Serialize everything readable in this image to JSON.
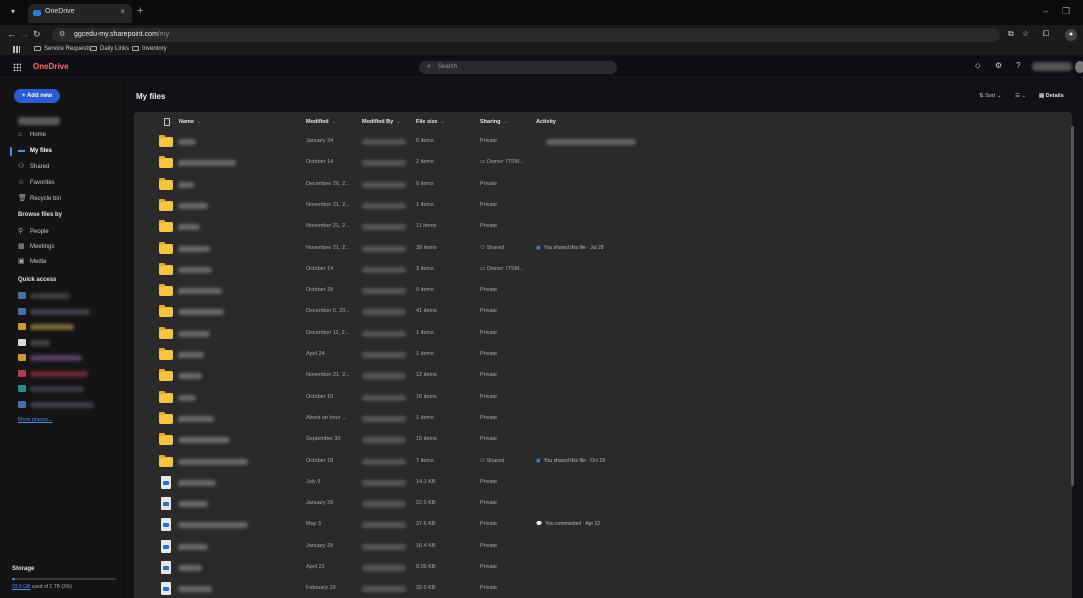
{
  "browser": {
    "tab_title": "OneDrive",
    "tab_close": "×",
    "new_tab": "+",
    "url_host": "ggcedu-my.sharepoint.com",
    "url_path": "/my",
    "bookmarks": [
      "Service Requests",
      "Daily Links",
      "Inventory"
    ]
  },
  "app": {
    "brand": "OneDrive",
    "search_placeholder": "Search",
    "help": "?"
  },
  "sidebar": {
    "add_new": "+ Add new",
    "nav": [
      {
        "label": "Home",
        "icon": "home-icon",
        "glyph": "⌂"
      },
      {
        "label": "My files",
        "icon": "folder-icon",
        "glyph": "▬",
        "active": true
      },
      {
        "label": "Shared",
        "icon": "people-icon",
        "glyph": "⚇"
      },
      {
        "label": "Favorites",
        "icon": "star-icon",
        "glyph": "☆"
      },
      {
        "label": "Recycle bin",
        "icon": "trash-icon",
        "glyph": "🗑"
      }
    ],
    "browse_by_label": "Browse files by",
    "browse": [
      {
        "label": "People",
        "icon": "person-icon",
        "glyph": "⚲"
      },
      {
        "label": "Meetings",
        "icon": "calendar-icon",
        "glyph": "▦"
      },
      {
        "label": "Media",
        "icon": "image-icon",
        "glyph": "▣"
      }
    ],
    "quick_access_label": "Quick access",
    "more_places": "More places...",
    "storage_label": "Storage",
    "storage_used": "33.5 GB",
    "storage_rest": " used of 1 TB (3%)",
    "storage_fraction": 0.03
  },
  "main": {
    "title": "My files",
    "sort": "Sort",
    "details": "Details",
    "columns": {
      "name": "Name",
      "modified": "Modified",
      "modified_by": "Modified By",
      "file_size": "File size",
      "sharing": "Sharing",
      "activity": "Activity"
    },
    "rows": [
      {
        "type": "folder",
        "modified": "January 24",
        "size": "0 items",
        "sharing": "Private",
        "activity": ""
      },
      {
        "type": "folder",
        "modified": "October 14",
        "size": "2 items",
        "sharing": "Owner: ITSM...",
        "activity": ""
      },
      {
        "type": "folder",
        "modified": "December 20, 2...",
        "size": "0 items",
        "sharing": "Private",
        "activity": ""
      },
      {
        "type": "folder",
        "modified": "November 21, 2...",
        "size": "1 items",
        "sharing": "Private",
        "activity": ""
      },
      {
        "type": "folder",
        "modified": "November 21, 2...",
        "size": "11 items",
        "sharing": "Private",
        "activity": ""
      },
      {
        "type": "folder",
        "modified": "November 21, 2...",
        "size": "39 items",
        "sharing": "Shared",
        "activity": "You shared this file · Jul 28"
      },
      {
        "type": "folder",
        "modified": "October 14",
        "size": "3 items",
        "sharing": "Owner: ITSM...",
        "activity": ""
      },
      {
        "type": "folder",
        "modified": "October 29",
        "size": "0 items",
        "sharing": "Private",
        "activity": ""
      },
      {
        "type": "folder",
        "modified": "December 5, 20...",
        "size": "41 items",
        "sharing": "Private",
        "activity": ""
      },
      {
        "type": "folder",
        "modified": "December 11, 2...",
        "size": "1 items",
        "sharing": "Private",
        "activity": ""
      },
      {
        "type": "folder",
        "modified": "April 24",
        "size": "1 items",
        "sharing": "Private",
        "activity": ""
      },
      {
        "type": "folder",
        "modified": "November 21, 2...",
        "size": "12 items",
        "sharing": "Private",
        "activity": ""
      },
      {
        "type": "folder",
        "modified": "October 10",
        "size": "16 items",
        "sharing": "Private",
        "activity": ""
      },
      {
        "type": "folder",
        "modified": "About an hour ...",
        "size": "1 items",
        "sharing": "Private",
        "activity": ""
      },
      {
        "type": "folder",
        "modified": "September 30",
        "size": "15 items",
        "sharing": "Private",
        "activity": ""
      },
      {
        "type": "folder",
        "modified": "October 18",
        "size": "7 items",
        "sharing": "Shared",
        "activity": "You shared this file · Oct 18"
      },
      {
        "type": "doc",
        "modified": "July 9",
        "size": "14.1 KB",
        "sharing": "Private",
        "activity": ""
      },
      {
        "type": "doc",
        "modified": "January 29",
        "size": "22.0 KB",
        "sharing": "Private",
        "activity": ""
      },
      {
        "type": "doc",
        "modified": "May 3",
        "size": "37.6 KB",
        "sharing": "Private",
        "activity": "You commented · Apr 22"
      },
      {
        "type": "doc",
        "modified": "January 29",
        "size": "16.4 KB",
        "sharing": "Private",
        "activity": ""
      },
      {
        "type": "doc",
        "modified": "April 22",
        "size": "8.09 KB",
        "sharing": "Private",
        "activity": ""
      },
      {
        "type": "doc",
        "modified": "February 29",
        "size": "32.0 KB",
        "sharing": "Private",
        "activity": ""
      }
    ]
  },
  "colors": {
    "accent": "#4d8cf5",
    "brand": "#ff6b6b",
    "add_new": "#2c5bd8",
    "folder": "#f5c542"
  }
}
